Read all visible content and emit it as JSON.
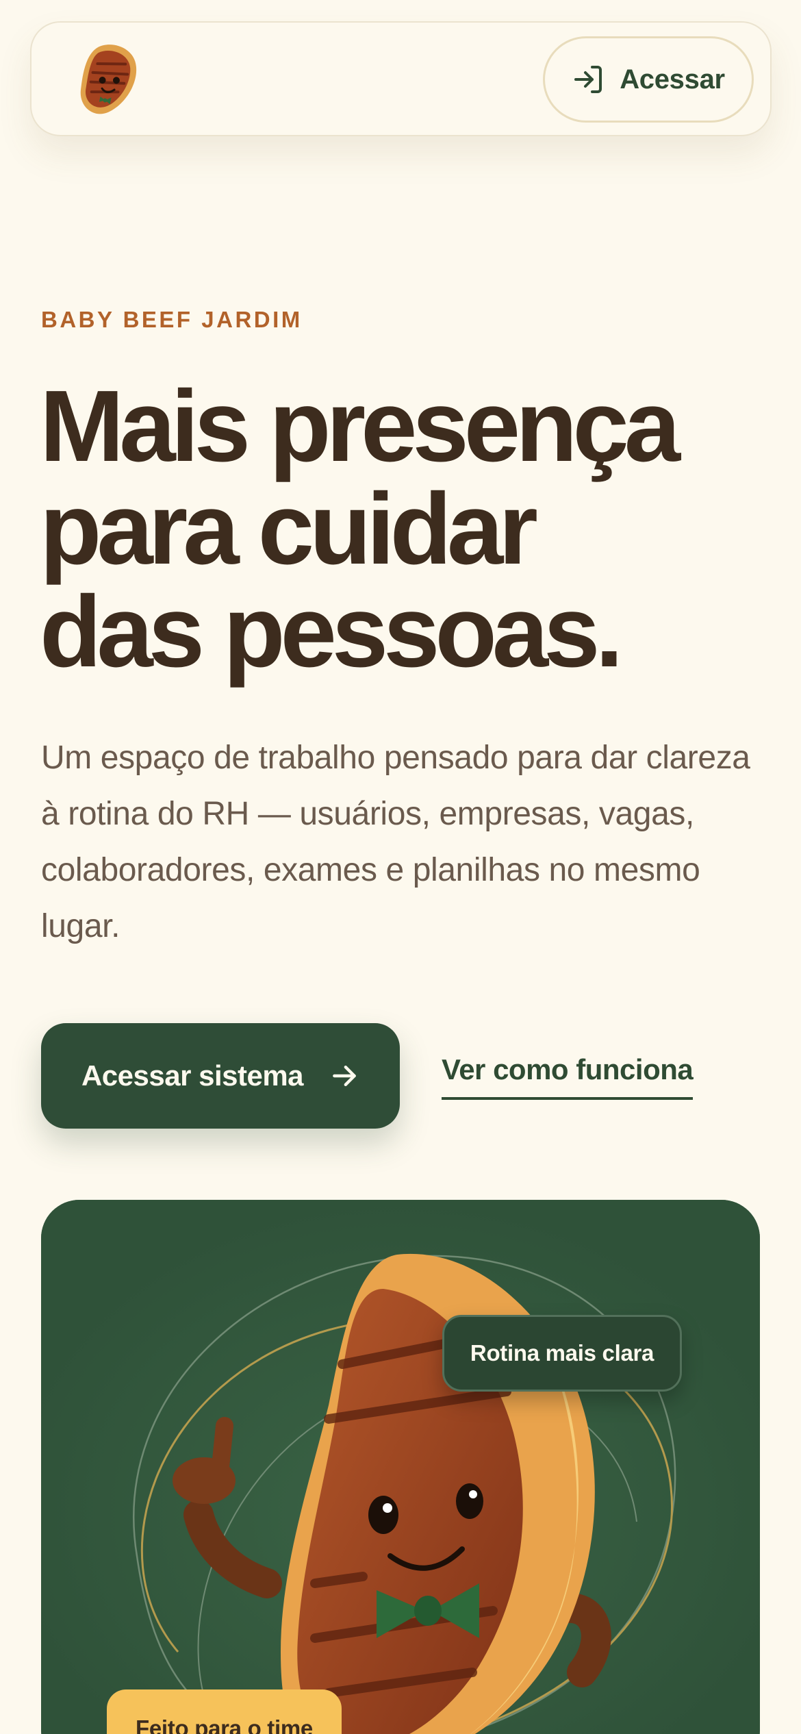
{
  "header": {
    "logo_icon": "steak-mascot-logo-icon",
    "login_label": "Acessar",
    "login_icon": "sign-in-icon"
  },
  "hero": {
    "eyebrow": "BABY BEEF JARDIM",
    "headline_lines": [
      "Mais presença",
      "para cuidar",
      "das pessoas."
    ],
    "lede": "Um espaço de trabalho pensado para dar clareza à rotina do RH — usuários, empresas, vagas, colaboradores, exames e planilhas no mesmo lugar."
  },
  "cta": {
    "primary_label": "Acessar sistema",
    "primary_icon": "arrow-right-icon",
    "secondary_label": "Ver como funciona"
  },
  "showcase": {
    "mascot_icon": "steak-mascot-illustration",
    "badge_top": "Rotina mais clara",
    "badge_bottom": "Feito para o time"
  },
  "colors": {
    "background": "#fdf9ee",
    "brand_green": "#2f4d37",
    "accent_orange": "#b2622a",
    "accent_yellow": "#f6c25a",
    "text_dark": "#3d2c1e"
  }
}
